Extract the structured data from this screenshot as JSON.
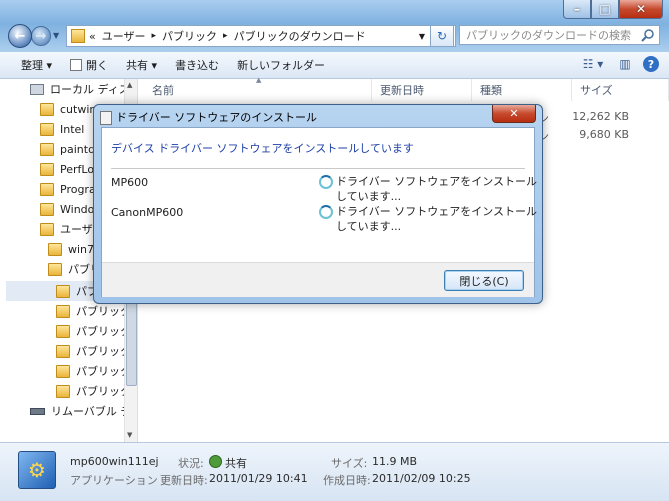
{
  "window": {
    "caption_buttons": {
      "minimize": "–",
      "maximize": "□",
      "close": "✕"
    }
  },
  "nav": {
    "back_icon": "←",
    "forward_icon": "→",
    "address": {
      "separator": "«",
      "crumbs": [
        "ユーザー",
        "パブリック",
        "パブリックのダウンロード"
      ],
      "crumb_sep": "▸"
    },
    "refresh_icon": "↻",
    "search_placeholder": "パブリックのダウンロードの検索"
  },
  "toolbar": {
    "organize": "整理 ▾",
    "open": "開く",
    "share": "共有 ▾",
    "burn": "書き込む",
    "new_folder": "新しいフォルダー",
    "view_icon": "☷ ▾",
    "pane_icon": "▥",
    "help_icon": "?"
  },
  "navpane": {
    "items": [
      {
        "label": "ローカル ディス",
        "kind": "drive"
      },
      {
        "label": "cutwin",
        "kind": "folder"
      },
      {
        "label": "Intel",
        "kind": "folder"
      },
      {
        "label": "paintdat",
        "kind": "folder"
      },
      {
        "label": "PerfLogs",
        "kind": "folder"
      },
      {
        "label": "Program",
        "kind": "folder"
      },
      {
        "label": "Window",
        "kind": "folder"
      },
      {
        "label": "ユーザー",
        "kind": "folder"
      },
      {
        "label": "win7_",
        "kind": "folder"
      },
      {
        "label": "パブリ",
        "kind": "folder"
      },
      {
        "label": "パブ",
        "kind": "folder"
      },
      {
        "label": "パブリック",
        "kind": "folder"
      },
      {
        "label": "パブリック",
        "kind": "folder"
      },
      {
        "label": "パブリック",
        "kind": "folder"
      },
      {
        "label": "パブリック",
        "kind": "folder"
      },
      {
        "label": "パブリック",
        "kind": "folder"
      },
      {
        "label": "リムーバブル デ",
        "kind": "drive"
      }
    ]
  },
  "content": {
    "columns": [
      "名前",
      "更新日時",
      "種類",
      "サイズ"
    ],
    "sizes": [
      "12,262 KB",
      "9,680 KB"
    ],
    "type_stub": "ン"
  },
  "details": {
    "filename": "mp600win111ej",
    "type": "アプリケーション",
    "status_label": "状況:",
    "status_value": "共有",
    "size_label": "サイズ:",
    "size_value": "11.9 MB",
    "modified_label": "更新日時:",
    "modified_value": "2011/01/29 10:41",
    "created_label": "作成日時:",
    "created_value": "2011/02/09 10:25"
  },
  "dialog": {
    "title": "ドライバー ソフトウェアのインストール",
    "close_icon": "✕",
    "heading": "デバイス ドライバー ソフトウェアをインストールしています",
    "devices": [
      {
        "name": "MP600",
        "status_line1": "ドライバー ソフトウェアをインストール",
        "status_line2": "しています..."
      },
      {
        "name": "CanonMP600",
        "status_line1": "ドライバー ソフトウェアをインストール",
        "status_line2": "しています..."
      }
    ],
    "close_button": "閉じる(C)"
  }
}
